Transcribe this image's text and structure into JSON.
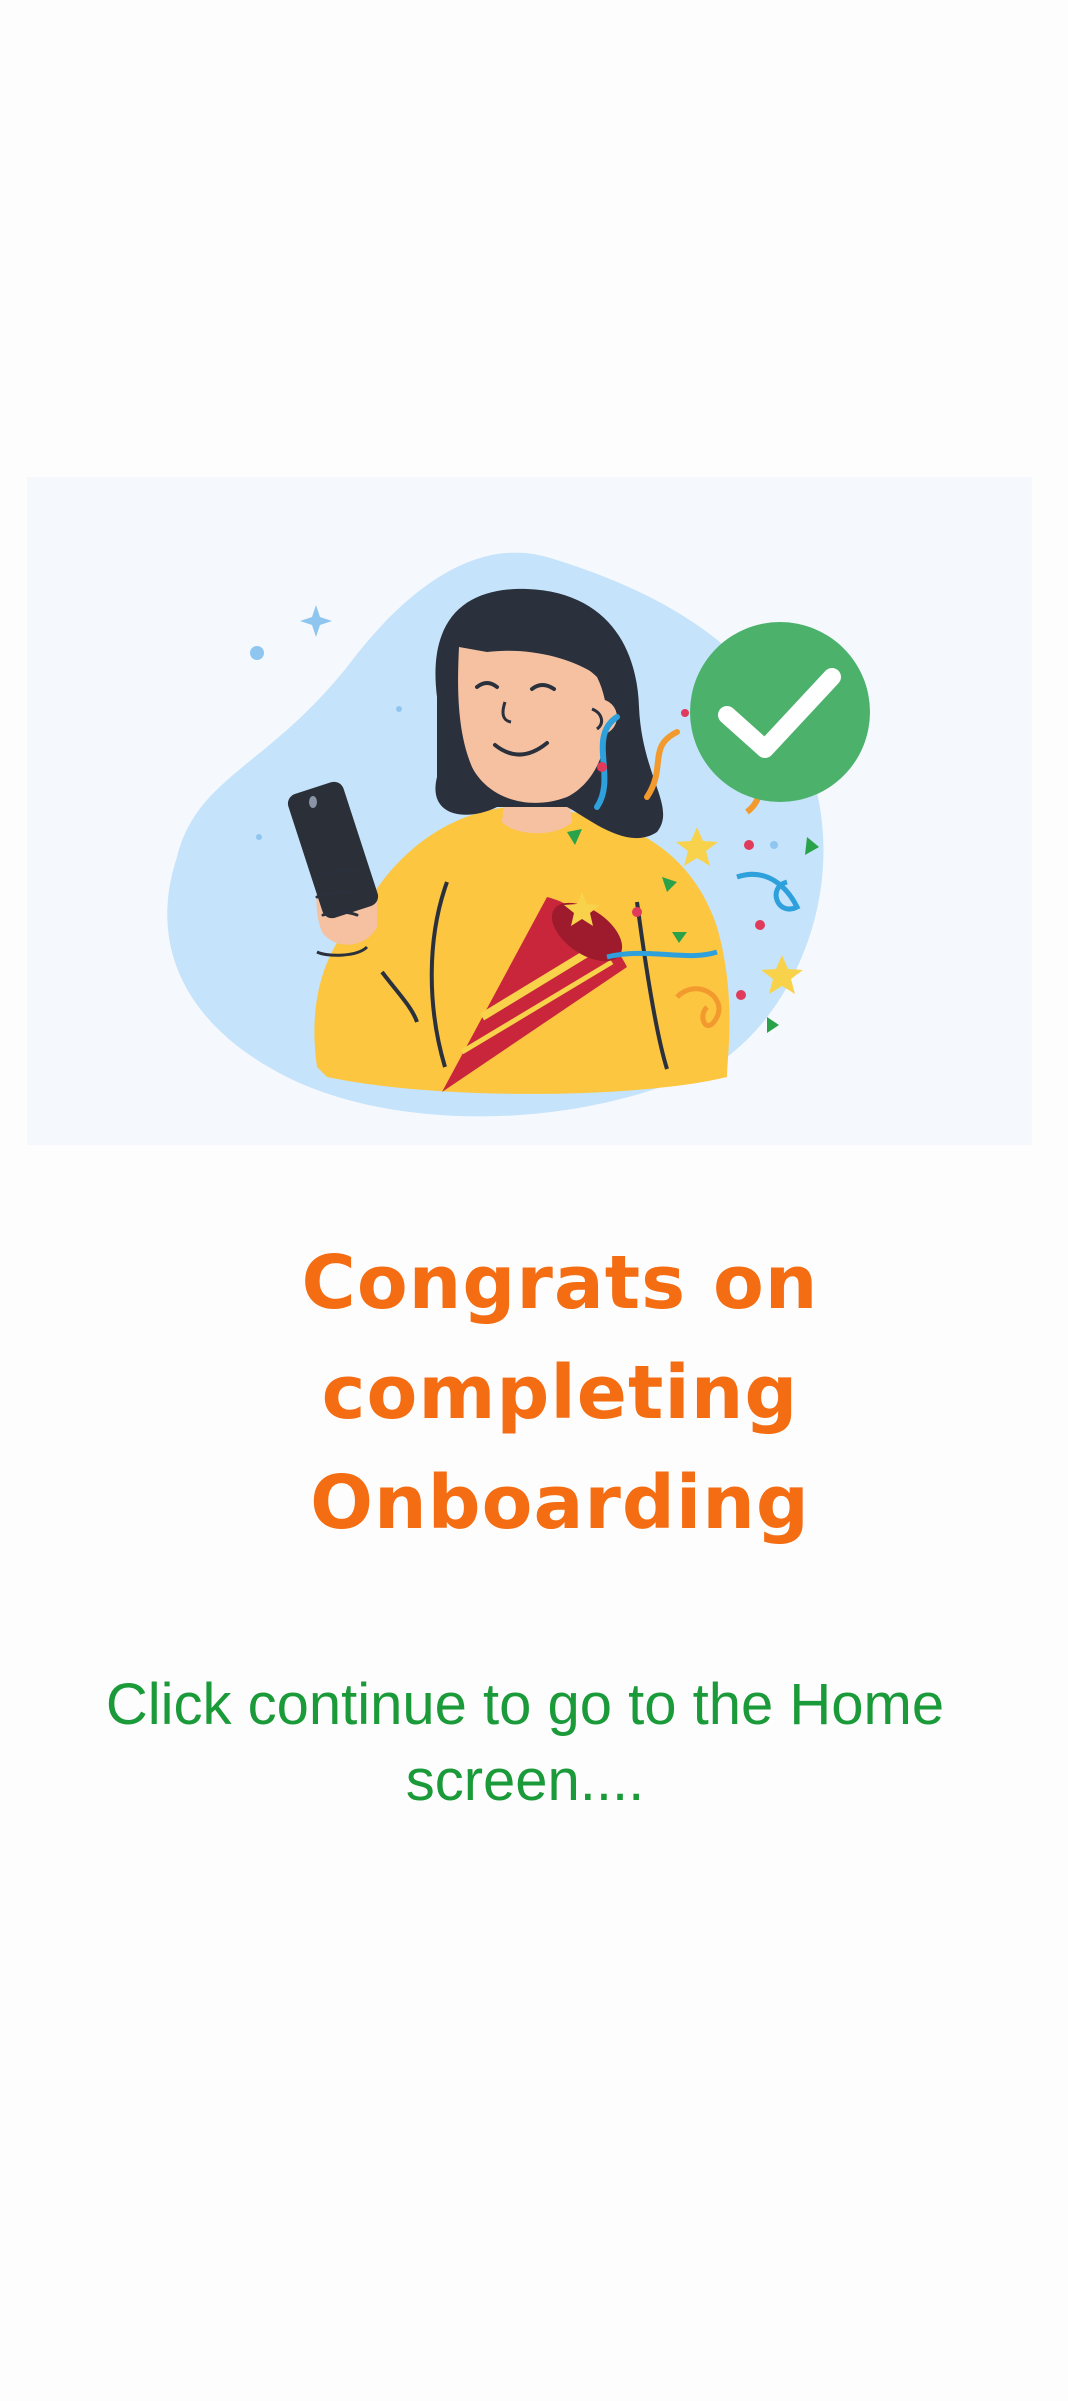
{
  "colors": {
    "title": "#f46d12",
    "subtitle": "#1a9a38",
    "check_circle": "#4cb26b",
    "blob": "#c5e3fa",
    "shirt": "#fcc640",
    "hair": "#2a303c",
    "skin": "#f5c1a1",
    "popper": "#c9263b"
  },
  "illustration": {
    "icon": "celebration-woman-with-phone-illustration"
  },
  "onboarding": {
    "title": "Congrats on completing Onboarding",
    "message": "Click continue to go to the Home screen...."
  }
}
